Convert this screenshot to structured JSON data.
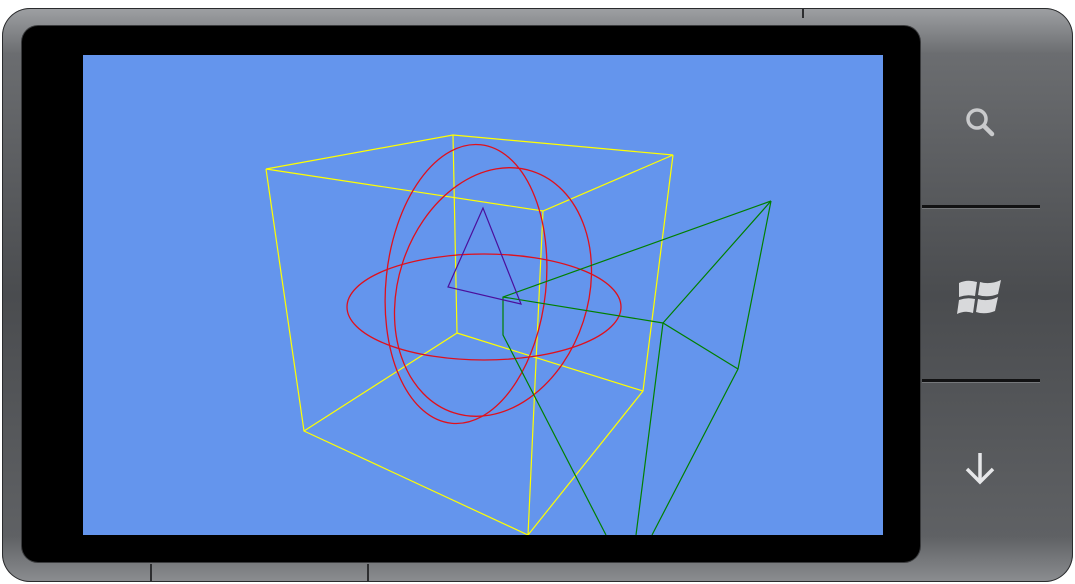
{
  "device": {
    "buttons": [
      {
        "icon": "search-icon"
      },
      {
        "icon": "windows-logo-icon"
      },
      {
        "icon": "back-arrow-icon"
      }
    ]
  },
  "scene": {
    "background_color": "#6495ed",
    "objects": [
      {
        "name": "cube",
        "color": "#ffff00"
      },
      {
        "name": "sphere",
        "color": "#e0101c"
      },
      {
        "name": "pyramid",
        "color": "#008000"
      },
      {
        "name": "triangle",
        "color": "#4b0f9c"
      }
    ]
  }
}
